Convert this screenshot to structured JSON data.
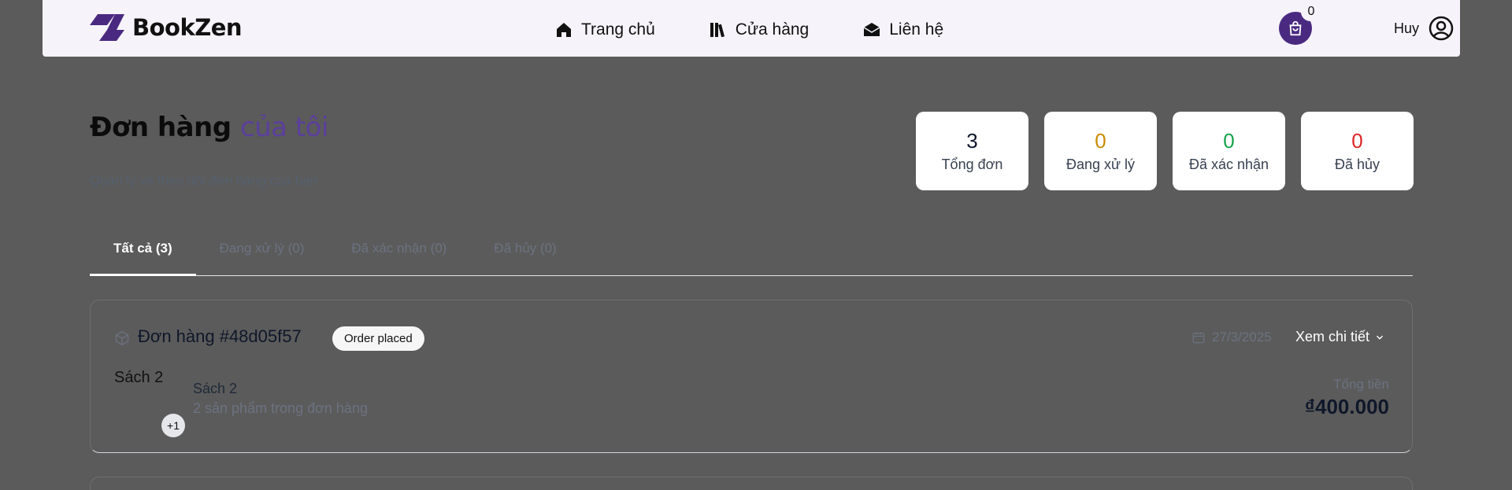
{
  "brand": {
    "name": "BookZen"
  },
  "nav": [
    {
      "label": "Trang chủ",
      "icon": "home-icon"
    },
    {
      "label": "Cửa hàng",
      "icon": "books-icon"
    },
    {
      "label": "Liên hệ",
      "icon": "envelope-open-icon"
    }
  ],
  "cart": {
    "count": "0",
    "icon": "shopping-bag-icon"
  },
  "user": {
    "name": "Huy",
    "icon": "user-circle-icon"
  },
  "page": {
    "title_main": "Đơn hàng",
    "title_accent": "của tôi",
    "subtitle": "Quản lý và theo dõi đơn hàng của bạn"
  },
  "stats": [
    {
      "value": "3",
      "label": "Tổng đơn",
      "color": "#0f172a"
    },
    {
      "value": "0",
      "label": "Đang xử lý",
      "color": "#ca8a04"
    },
    {
      "value": "0",
      "label": "Đã xác nhận",
      "color": "#16a34a"
    },
    {
      "value": "0",
      "label": "Đã hủy",
      "color": "#dc2626"
    }
  ],
  "tabs": [
    {
      "label": "Tất cả (3)",
      "active": true
    },
    {
      "label": "Đang xử lý (0)",
      "active": false
    },
    {
      "label": "Đã xác nhận (0)",
      "active": false
    },
    {
      "label": "Đã hủy (0)",
      "active": false
    }
  ],
  "order": {
    "id": "Đơn hàng #48d05f57",
    "status": "Order placed",
    "date": "27/3/2025",
    "view_detail": "Xem chi tiết",
    "thumb_alt": "Sách 2",
    "more_badge": "+1",
    "product_name": "Sách 2",
    "product_count": "2 sản phẩm trong đơn hàng",
    "total_label": "Tổng tiền",
    "total_value": "₫400.000"
  },
  "colors": {
    "brand": "#4a2a80",
    "overlay": "#5b5b5b"
  }
}
